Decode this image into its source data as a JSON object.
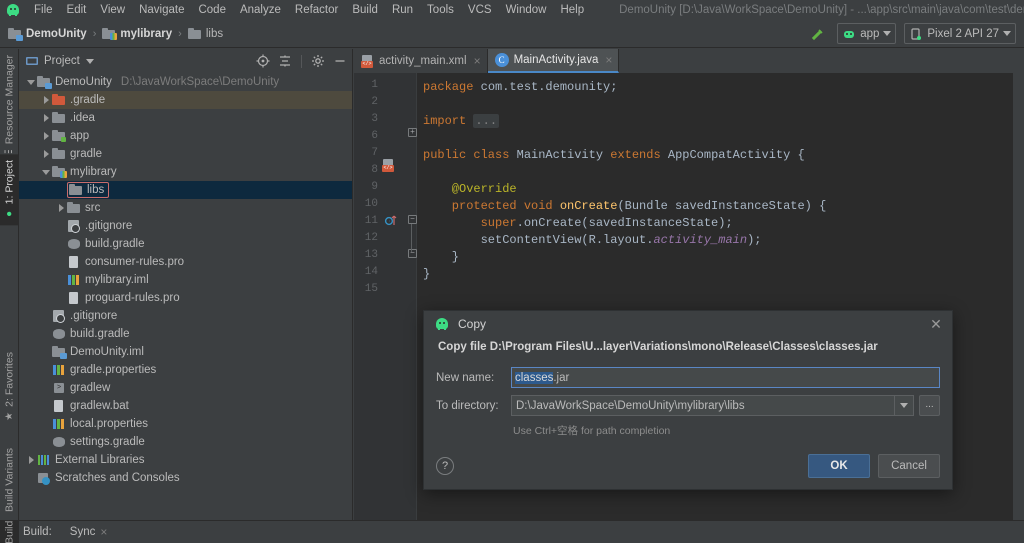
{
  "window": {
    "title": "DemoUnity [D:\\Java\\WorkSpace\\DemoUnity] - ...\\app\\src\\main\\java\\com\\test\\demounity\\MainActi",
    "app_icon": "android-studio-icon"
  },
  "menubar": {
    "items": [
      {
        "label": "File"
      },
      {
        "label": "Edit"
      },
      {
        "label": "View"
      },
      {
        "label": "Navigate"
      },
      {
        "label": "Code"
      },
      {
        "label": "Analyze"
      },
      {
        "label": "Refactor"
      },
      {
        "label": "Build"
      },
      {
        "label": "Run"
      },
      {
        "label": "Tools"
      },
      {
        "label": "VCS"
      },
      {
        "label": "Window"
      },
      {
        "label": "Help"
      }
    ]
  },
  "breadcrumb": {
    "separator": "›",
    "items": [
      {
        "label": "DemoUnity",
        "icon": "project-folder-icon"
      },
      {
        "label": "mylibrary",
        "icon": "module-folder-icon"
      },
      {
        "label": "libs",
        "icon": "folder-icon"
      }
    ]
  },
  "toolbar_right": {
    "build_icon": "hammer-icon",
    "run_config": {
      "label": "app",
      "icon": "android-icon"
    },
    "device": {
      "label": "Pixel 2 API 27",
      "icon": "phone-icon"
    }
  },
  "left_tool_strip": {
    "tabs": [
      {
        "label": "Resource Manager",
        "icon": "resource-manager-icon",
        "active": false
      },
      {
        "label": "1: Project",
        "icon": "project-icon",
        "active": true
      },
      {
        "label": "2: Favorites",
        "icon": "star-icon",
        "active": false
      },
      {
        "label": "Build Variants",
        "icon": "variants-icon",
        "active": false
      }
    ]
  },
  "project_panel": {
    "title": "Project",
    "title_icon": "project-view-icon",
    "dropdown_icon": "chevron-down-icon",
    "header_buttons": [
      {
        "name": "locate-icon"
      },
      {
        "name": "collapse-all-icon"
      },
      {
        "name": "gear-icon"
      },
      {
        "name": "hide-icon"
      }
    ],
    "tree": [
      {
        "label": "DemoUnity",
        "path": "D:\\JavaWorkSpace\\DemoUnity",
        "indent": 0,
        "twisty": "down",
        "icon": "project-folder-icon",
        "state": "normal"
      },
      {
        "label": ".gradle",
        "indent": 1,
        "twisty": "right",
        "icon": "folder-orange-icon",
        "state": "highlight"
      },
      {
        "label": ".idea",
        "indent": 1,
        "twisty": "right",
        "icon": "folder-icon",
        "state": "normal"
      },
      {
        "label": "app",
        "indent": 1,
        "twisty": "right",
        "icon": "module-folder-icon",
        "state": "normal"
      },
      {
        "label": "gradle",
        "indent": 1,
        "twisty": "right",
        "icon": "folder-icon",
        "state": "normal"
      },
      {
        "label": "mylibrary",
        "indent": 1,
        "twisty": "down",
        "icon": "library-folder-icon",
        "state": "normal"
      },
      {
        "label": "libs",
        "indent": 2,
        "twisty": "none",
        "icon": "folder-icon",
        "state": "selected"
      },
      {
        "label": "src",
        "indent": 2,
        "twisty": "right",
        "icon": "folder-icon",
        "state": "normal"
      },
      {
        "label": ".gitignore",
        "indent": 2,
        "twisty": "none",
        "icon": "gitignore-icon",
        "state": "normal"
      },
      {
        "label": "build.gradle",
        "indent": 2,
        "twisty": "none",
        "icon": "gradle-file-icon",
        "state": "normal"
      },
      {
        "label": "consumer-rules.pro",
        "indent": 2,
        "twisty": "none",
        "icon": "pro-file-icon",
        "state": "normal"
      },
      {
        "label": "mylibrary.iml",
        "indent": 2,
        "twisty": "none",
        "icon": "iml-file-icon",
        "state": "normal"
      },
      {
        "label": "proguard-rules.pro",
        "indent": 2,
        "twisty": "none",
        "icon": "pro-file-icon",
        "state": "normal"
      },
      {
        "label": ".gitignore",
        "indent": 1,
        "twisty": "none",
        "icon": "gitignore-icon",
        "state": "normal"
      },
      {
        "label": "build.gradle",
        "indent": 1,
        "twisty": "none",
        "icon": "gradle-file-icon",
        "state": "normal"
      },
      {
        "label": "DemoUnity.iml",
        "indent": 1,
        "twisty": "none",
        "icon": "iml-project-icon",
        "state": "normal"
      },
      {
        "label": "gradle.properties",
        "indent": 1,
        "twisty": "none",
        "icon": "properties-file-icon",
        "state": "normal"
      },
      {
        "label": "gradlew",
        "indent": 1,
        "twisty": "none",
        "icon": "script-file-icon",
        "state": "normal"
      },
      {
        "label": "gradlew.bat",
        "indent": 1,
        "twisty": "none",
        "icon": "bat-file-icon",
        "state": "normal"
      },
      {
        "label": "local.properties",
        "indent": 1,
        "twisty": "none",
        "icon": "properties-file-icon",
        "state": "normal"
      },
      {
        "label": "settings.gradle",
        "indent": 1,
        "twisty": "none",
        "icon": "gradle-file-icon",
        "state": "normal"
      },
      {
        "label": "External Libraries",
        "indent": 0,
        "twisty": "right",
        "icon": "external-libraries-icon",
        "state": "normal"
      },
      {
        "label": "Scratches and Consoles",
        "indent": 0,
        "twisty": "none",
        "icon": "scratches-icon",
        "state": "normal"
      }
    ]
  },
  "editor": {
    "tabs": [
      {
        "label": "activity_main.xml",
        "icon": "xml-file-icon",
        "active": false,
        "close": "×"
      },
      {
        "label": "MainActivity.java",
        "icon": "java-class-icon",
        "active": true,
        "close": "×"
      }
    ],
    "line_numbers": [
      "1",
      "2",
      "3",
      "6",
      "7",
      "8",
      "9",
      "10",
      "11",
      "12",
      "13",
      "14",
      "15"
    ],
    "code_lines": [
      {
        "n": "1",
        "segments": [
          {
            "t": "package",
            "c": "k"
          },
          {
            "t": " com.test.demounity;",
            "c": "t"
          }
        ]
      },
      {
        "n": "2",
        "segments": []
      },
      {
        "n": "3",
        "segments": [
          {
            "t": "import",
            "c": "k"
          },
          {
            "t": " ",
            "c": "t"
          },
          {
            "t": "...",
            "c": "fold"
          }
        ]
      },
      {
        "n": "6",
        "segments": []
      },
      {
        "n": "7",
        "segments": [
          {
            "t": "public class",
            "c": "k"
          },
          {
            "t": " MainActivity ",
            "c": "t"
          },
          {
            "t": "extends",
            "c": "k"
          },
          {
            "t": " AppCompatActivity {",
            "c": "t"
          }
        ]
      },
      {
        "n": "8",
        "segments": []
      },
      {
        "n": "9",
        "segments": [
          {
            "t": "    @Override",
            "c": "an"
          }
        ]
      },
      {
        "n": "10",
        "segments": [
          {
            "t": "    protected void ",
            "c": "k"
          },
          {
            "t": "onCreate",
            "c": "fn"
          },
          {
            "t": "(Bundle savedInstanceState) {",
            "c": "t"
          }
        ]
      },
      {
        "n": "11",
        "segments": [
          {
            "t": "        super",
            "c": "k"
          },
          {
            "t": ".onCreate(savedInstanceState);",
            "c": "t"
          }
        ]
      },
      {
        "n": "12",
        "segments": [
          {
            "t": "        setContentView(R.layout.",
            "c": "t"
          },
          {
            "t": "activity_main",
            "c": "it"
          },
          {
            "t": ");",
            "c": "t"
          }
        ]
      },
      {
        "n": "13",
        "segments": [
          {
            "t": "    }",
            "c": "t"
          }
        ]
      },
      {
        "n": "14",
        "segments": [
          {
            "t": "}",
            "c": "t"
          }
        ]
      },
      {
        "n": "15",
        "segments": []
      }
    ],
    "gutter_markers": [
      {
        "line": "7",
        "icon": "layout-preview-icon"
      },
      {
        "line": "10",
        "icon": "override-method-icon"
      }
    ]
  },
  "dialog": {
    "icon": "android-studio-icon",
    "title": "Copy",
    "close_icon": "close-icon",
    "message": "Copy file D:\\Program Files\\U...layer\\Variations\\mono\\Release\\Classes\\classes.jar",
    "new_name": {
      "label": "New name:",
      "value_selected": "classes",
      "value_rest": ".jar"
    },
    "to_directory": {
      "label": "To directory:",
      "value": "D:\\JavaWorkSpace\\DemoUnity\\mylibrary\\libs",
      "dropdown_icon": "chevron-down-icon",
      "browse_label": "..."
    },
    "hint": "Use Ctrl+空格 for path completion",
    "help_label": "?",
    "ok_label": "OK",
    "cancel_label": "Cancel"
  },
  "statusbar": {
    "build_tab": "Build",
    "items": [
      {
        "label": "Build:"
      },
      {
        "label": "Sync",
        "close": "×"
      }
    ]
  },
  "colors": {
    "chrome": "#3c3f41",
    "editor_bg": "#2b2b2b",
    "gutter_bg": "#313335",
    "selection_blue": "#0d293e",
    "accent_blue": "#365880",
    "gradle_highlight": "#4e4a3e",
    "selection_outline": "#c96c6c",
    "green": "#3ddc84"
  }
}
